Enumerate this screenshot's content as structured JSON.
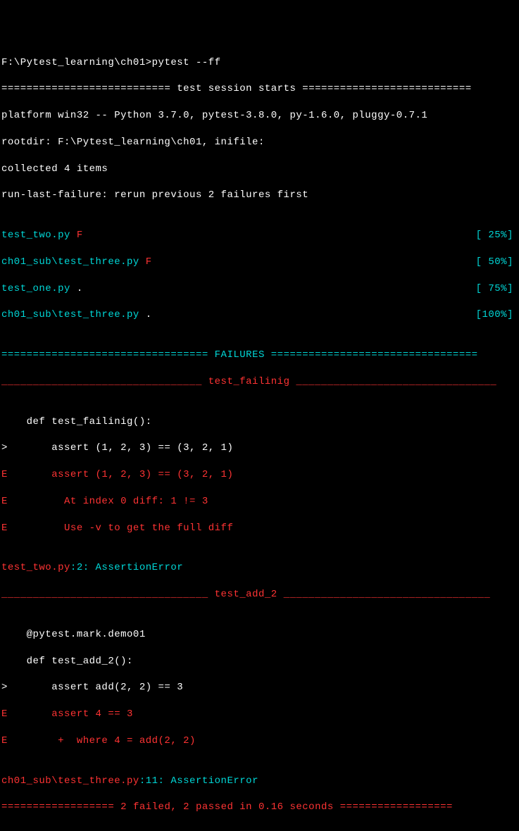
{
  "prompt": {
    "path": "F:\\Pytest_learning\\ch01>",
    "cmd": "pytest --ff"
  },
  "header": {
    "rule_left": "=========================== ",
    "title": "test session starts",
    "rule_right": " ===========================",
    "platform": "platform win32 -- Python 3.7.0, pytest-3.8.0, py-1.6.0, pluggy-0.7.1",
    "rootdir": "rootdir: F:\\Pytest_learning\\ch01, inifile:",
    "collected": "collected 4 items",
    "runlast": "run-last-failure: rerun previous 2 failures first"
  },
  "runs": [
    {
      "name": "test_two.py ",
      "mark": "F",
      "pct": "[ 25%]"
    },
    {
      "name": "ch01_sub\\test_three.py ",
      "mark": "F",
      "pct": "[ 50%]"
    },
    {
      "name": "test_one.py ",
      "mark": ".",
      "pct": "[ 75%]"
    },
    {
      "name": "ch01_sub\\test_three.py ",
      "mark": ".",
      "pct": "[100%]"
    }
  ],
  "fail_header": {
    "rule_left": "================================= ",
    "title": "FAILURES",
    "rule_right": " ================================="
  },
  "fail1": {
    "name_rule_left": "________________________________ ",
    "name": "test_failinig",
    "name_rule_right": " ________________________________",
    "def": "    def test_failinig():",
    "caret": ">       assert (1, 2, 3) == (3, 2, 1)",
    "e1": "E       assert (1, 2, 3) == (3, 2, 1)",
    "e2": "E         At index 0 diff: 1 != 3",
    "e3": "E         Use -v to get the full diff",
    "loc_file": "test_two.py",
    "loc_rest": ":2: AssertionError"
  },
  "fail2": {
    "name_rule_left": "_________________________________ ",
    "name": "test_add_2",
    "name_rule_right": " _________________________________",
    "deco": "    @pytest.mark.demo01",
    "def": "    def test_add_2():",
    "caret": ">       assert add(2, 2) == 3",
    "e1": "E       assert 4 == 3",
    "e2": "E        +  where 4 = add(2, 2)",
    "loc_file": "ch01_sub\\test_three.py",
    "loc_rest": ":11: AssertionError"
  },
  "summary": {
    "rule_left": "================== ",
    "text": "2 failed, 2 passed in 0.16 seconds",
    "rule_right": " =================="
  }
}
